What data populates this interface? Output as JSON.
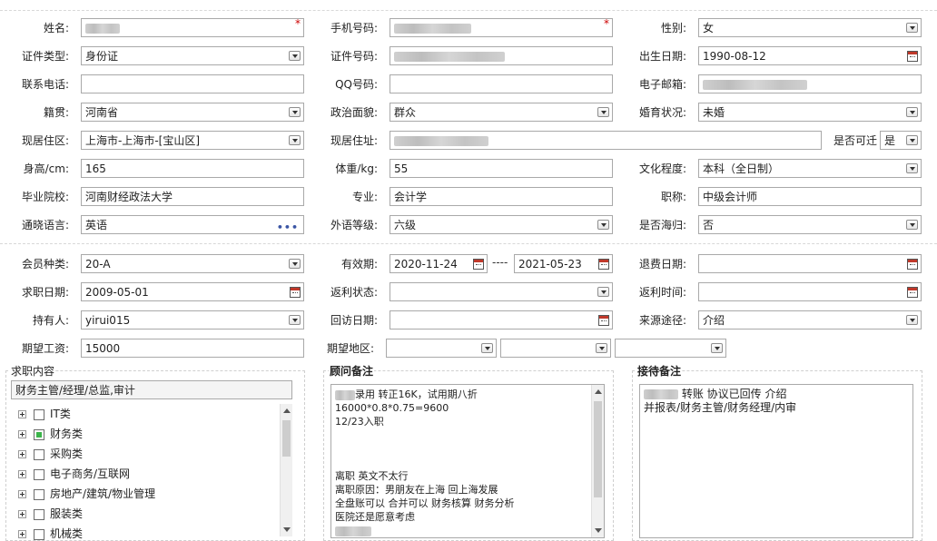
{
  "form1": {
    "name": {
      "label": "姓名:",
      "value": ""
    },
    "mobile": {
      "label": "手机号码:",
      "value": ""
    },
    "gender": {
      "label": "性别:",
      "value": "女"
    },
    "id_type": {
      "label": "证件类型:",
      "value": "身份证"
    },
    "id_number": {
      "label": "证件号码:",
      "value": ""
    },
    "birth_date": {
      "label": "出生日期:",
      "value": "1990-08-12"
    },
    "phone": {
      "label": "联系电话:",
      "value": ""
    },
    "qq": {
      "label": "QQ号码:",
      "value": ""
    },
    "email": {
      "label": "电子邮箱:",
      "value": ""
    },
    "native_place": {
      "label": "籍贯:",
      "value": "河南省"
    },
    "political": {
      "label": "政治面貌:",
      "value": "群众"
    },
    "marital": {
      "label": "婚育状况:",
      "value": "未婚"
    },
    "residence": {
      "label": "现居住区:",
      "value": "上海市-上海市-[宝山区]"
    },
    "address": {
      "label": "现居住址:",
      "value": ""
    },
    "movable": {
      "label": "是否可迁",
      "value": "是"
    },
    "height": {
      "label": "身高/cm:",
      "value": "165"
    },
    "weight": {
      "label": "体重/kg:",
      "value": "55"
    },
    "education": {
      "label": "文化程度:",
      "value": "本科（全日制）"
    },
    "school": {
      "label": "毕业院校:",
      "value": "河南财经政法大学"
    },
    "major": {
      "label": "专业:",
      "value": "会计学"
    },
    "title": {
      "label": "职称:",
      "value": "中级会计师"
    },
    "language": {
      "label": "通晓语言:",
      "value": "英语"
    },
    "lang_level": {
      "label": "外语等级:",
      "value": "六级"
    },
    "overseas": {
      "label": "是否海归:",
      "value": "否"
    }
  },
  "form2": {
    "member_type": {
      "label": "会员种类:",
      "value": "20-A"
    },
    "validity": {
      "label": "有效期:",
      "from": "2020-11-24",
      "sep": "----",
      "to": "2021-05-23"
    },
    "refund_date": {
      "label": "退费日期:",
      "value": ""
    },
    "job_date": {
      "label": "求职日期:",
      "value": "2009-05-01"
    },
    "rebate_status": {
      "label": "返利状态:",
      "value": ""
    },
    "rebate_time": {
      "label": "返利时间:",
      "value": ""
    },
    "holder": {
      "label": "持有人:",
      "value": "yirui015"
    },
    "visit_date": {
      "label": "回访日期:",
      "value": ""
    },
    "source": {
      "label": "来源途径:",
      "value": "介绍"
    },
    "salary": {
      "label": "期望工资:",
      "value": "15000"
    },
    "area": {
      "label": "期望地区:",
      "v1": "",
      "v2": "",
      "v3": ""
    }
  },
  "job_panel": {
    "title": "求职内容",
    "selected": "财务主管/经理/总监,审计",
    "categories": [
      {
        "label": "IT类",
        "checked": false
      },
      {
        "label": "财务类",
        "checked": true
      },
      {
        "label": "采购类",
        "checked": false
      },
      {
        "label": "电子商务/互联网",
        "checked": false
      },
      {
        "label": "房地产/建筑/物业管理",
        "checked": false
      },
      {
        "label": "服装类",
        "checked": false
      },
      {
        "label": "机械类",
        "checked": false
      }
    ]
  },
  "consultant_panel": {
    "title": "顾问备注",
    "lines": [
      "录用 转正16K，试用期八折",
      "16000*0.8*0.75=9600",
      "12/23入职",
      "",
      "",
      "",
      "离职 英文不太行",
      "离职原因：男朋友在上海 回上海发展",
      "全盘账可以 合并可以  财务核算 财务分析",
      "医院还是愿意考虑"
    ]
  },
  "reception_panel": {
    "title": "接待备注",
    "lines": [
      "转账 协议已回传 介绍",
      " 并报表/财务主管/财务经理/内审"
    ]
  }
}
